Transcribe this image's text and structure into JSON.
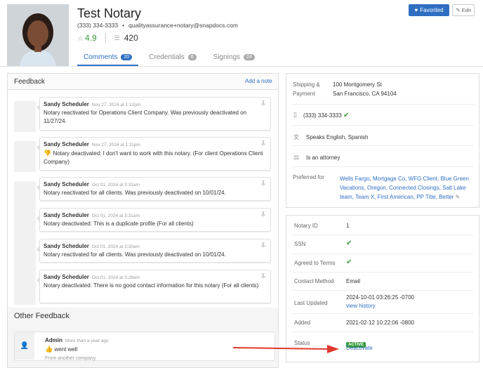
{
  "profile": {
    "name": "Test Notary",
    "phone": "(333) 334-3333",
    "email": "qualityassurance+notary@snapdocs.com",
    "rating": "4.9",
    "count": "420"
  },
  "actions": {
    "favorited": "Favorited",
    "edit": "Edit"
  },
  "tabs": [
    {
      "label": "Comments",
      "count": "20"
    },
    {
      "label": "Credentials",
      "count": "6"
    },
    {
      "label": "Signings",
      "count": "24"
    }
  ],
  "feedback": {
    "title": "Feedback",
    "add_note": "Add a note",
    "entries": [
      {
        "author": "Sandy Scheduler",
        "time": "Nov 27, 2024 at 1:12pm",
        "text": "Notary reactivated for Operations Client Company. Was previously deactivated on 11/27/24."
      },
      {
        "author": "Sandy Scheduler",
        "time": "Nov 27, 2024 at 1:11pm",
        "text": "Notary deactivated: I don't want to work with this notary. (For client Operations Client Company)"
      },
      {
        "author": "Sandy Scheduler",
        "time": "Oct 01, 2024 at 3:31am",
        "text": "Notary reactivated for all clients. Was previously deactivated on 10/01/24."
      },
      {
        "author": "Sandy Scheduler",
        "time": "Oct 01, 2024 at 3:31am",
        "text": "Notary deactivated: This is a duplicate profile (For all clients)"
      },
      {
        "author": "Sandy Scheduler",
        "time": "Oct 01, 2024 at 3:30am",
        "text": "Notary reactivated for all clients. Was previously deactivated on 10/01/24."
      },
      {
        "author": "Sandy Scheduler",
        "time": "Oct 01, 2024 at 3:28am",
        "text": "Notary deactivated: There is no good contact information for this notary (For all clients)"
      }
    ],
    "other_title": "Other Feedback",
    "other": {
      "author": "Admin",
      "time": "More than a year ago",
      "text": "went well",
      "source": "From another company"
    }
  },
  "details": {
    "shipping_label": "Shipping &",
    "payment_label": "Payment",
    "address1": "100 Montgomery St",
    "address2": "San Francisco, CA 94104",
    "phone": "(333) 334-3333",
    "languages": "Speaks English, Spanish",
    "attorney": "Is an attorney",
    "preferred_label": "Preferred for",
    "preferred": "Wells Fargo, Mortgage Co, WFG Client, Blue Green Vacations, Oregon, Connected Closings, Salt Lake team, Team X, First American, PP Title, Better"
  },
  "info": {
    "notary_id_label": "Notary ID",
    "notary_id": "1",
    "ssn_label": "SSN",
    "terms_label": "Agreed to Terms",
    "contact_method_label": "Contact Method",
    "contact_method": "Email",
    "last_updated_label": "Last Updated",
    "last_updated": "2024-10-01 03:26:25 -0700",
    "view_history": "view history",
    "added_label": "Added",
    "added": "2021-02-12 10:22:06 -0800",
    "status_label": "Status",
    "status": "ACTIVE",
    "deactivate": "Deactivate"
  },
  "colors": {
    "accent": "#2f6fc2",
    "success": "#3a9c3a",
    "danger": "#d9534f",
    "arrow": "#e03a2e"
  }
}
